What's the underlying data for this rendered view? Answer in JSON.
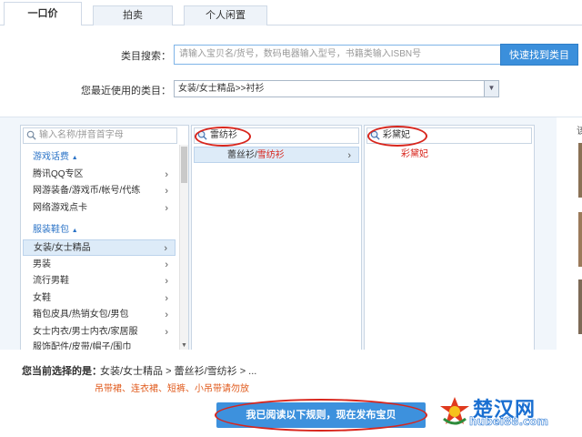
{
  "tabs": [
    {
      "label": "一口价",
      "active": true
    },
    {
      "label": "拍卖",
      "active": false
    },
    {
      "label": "个人闲置",
      "active": false
    }
  ],
  "search": {
    "label": "类目搜索：",
    "placeholder": "请输入宝贝名/货号，数码电器输入型号，书籍类输入ISBN号",
    "button": "快速找到类目"
  },
  "recent": {
    "label": "您最近使用的类目：",
    "value": "女装/女士精品>>衬衫"
  },
  "panels": {
    "left": {
      "search_placeholder": "输入名称/拼音首字母",
      "groups": [
        {
          "title": "游戏话费",
          "arrow": "▲",
          "items": [
            "腾讯QQ专区",
            "网游装备/游戏币/帐号/代练",
            "网络游戏点卡"
          ]
        },
        {
          "title": "服装鞋包",
          "arrow": "▲",
          "items": [
            "女装/女士精品",
            "男装",
            "流行男鞋",
            "女鞋",
            "箱包皮具/热销女包/男包",
            "女士内衣/男士内衣/家居服",
            "服饰配件/皮带/帽子/围巾"
          ]
        }
      ],
      "selected": "女装/女士精品"
    },
    "middle": {
      "search_value": "雷纺衫",
      "results": [
        {
          "prefix": "蕾丝衫/",
          "highlight": "雪纺衫"
        }
      ]
    },
    "right": {
      "search_value": "彩黛妃",
      "results": [
        "彩黛妃"
      ]
    }
  },
  "edge_glyph": "该",
  "bottom": {
    "current_label": "您当前选择的是：",
    "current_path": "女装/女士精品 > 蕾丝衫/雪纺衫 > ...",
    "warning": "吊带裙、连衣裙、短裤、小吊带请勿放",
    "publish_button": "我已阅读以下规则，现在发布宝贝"
  },
  "watermark": {
    "text": "楚汉网",
    "sub": "hubei88.com"
  },
  "colors": {
    "accent": "#3b8fdb",
    "selected_bg": "#ddebf8",
    "group_text": "#2c74c7",
    "highlight_red": "#d8261d",
    "warning_orange": "#e05a1c"
  }
}
